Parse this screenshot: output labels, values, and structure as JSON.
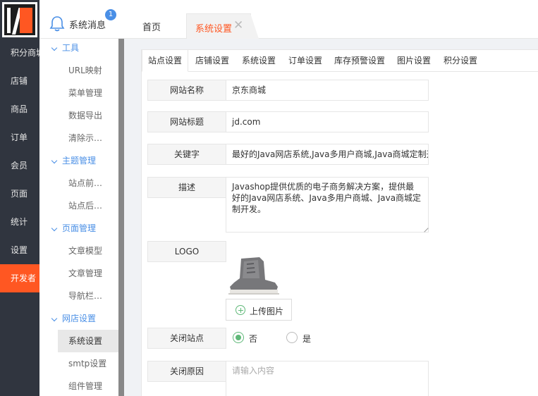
{
  "nav": {
    "items": [
      "积分商城",
      "店铺",
      "商品",
      "订单",
      "会员",
      "页面",
      "统计",
      "设置",
      "开发者"
    ],
    "active": "开发者"
  },
  "submenu": {
    "groups": [
      {
        "label": "工具",
        "items": [
          "URL映射",
          "菜单管理",
          "数据导出",
          "清除示…"
        ]
      },
      {
        "label": "主题管理",
        "items": [
          "站点前…",
          "站点后…"
        ]
      },
      {
        "label": "页面管理",
        "items": [
          "文章模型",
          "文章管理",
          "导航栏…"
        ]
      },
      {
        "label": "网店设置",
        "items": [
          "系统设置",
          "smtp设置",
          "组件管理"
        ]
      }
    ],
    "active": "系统设置"
  },
  "header": {
    "system_message": "系统消息",
    "badge_count": "1",
    "tabs": [
      {
        "label": "首页"
      },
      {
        "label": "系统设置",
        "close": "✕"
      }
    ]
  },
  "content_tabs": [
    "站点设置",
    "店铺设置",
    "系统设置",
    "订单设置",
    "库存预警设置",
    "图片设置",
    "积分设置"
  ],
  "form": {
    "site_name_label": "网站名称",
    "site_name_value": "京东商城",
    "site_title_label": "网站标题",
    "site_title_value": "jd.com",
    "keywords_label": "关键字",
    "keywords_value": "最好的Java网店系统,Java多用户商城,Java商城定制开发",
    "description_label": "描述",
    "description_value": "Javashop提供优质的电子商务解决方案，提供最好的Java网店系统、Java多用户商城、Java商城定制开发。",
    "logo_label": "LOGO",
    "upload_label": "上传图片",
    "close_site_label": "关闭站点",
    "close_site_options": [
      "否",
      "是"
    ],
    "close_site_selected": "否",
    "close_reason_label": "关闭原因",
    "close_reason_placeholder": "请输入内容"
  },
  "colors": {
    "accent": "#ff5722",
    "nav_bg": "#30353f",
    "link_blue": "#4a8fe6",
    "radio_green": "#5fb878"
  }
}
